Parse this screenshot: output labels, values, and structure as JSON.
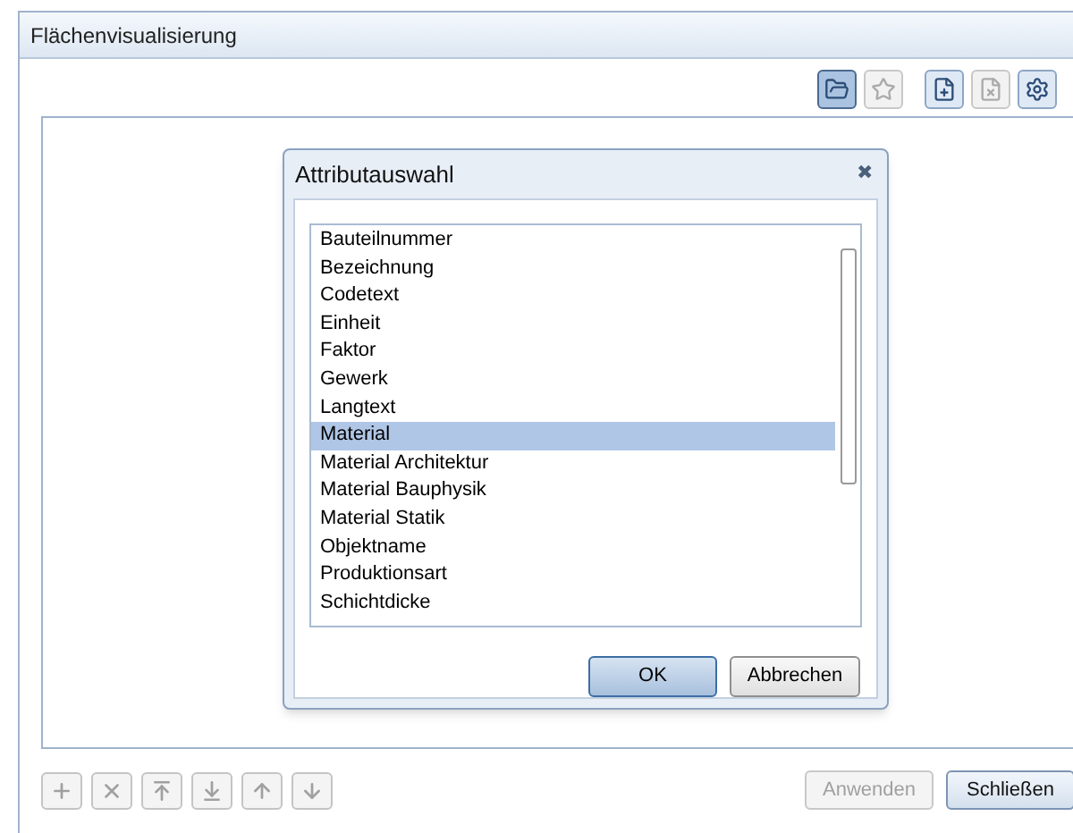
{
  "window": {
    "title": "Flächenvisualisierung"
  },
  "toolbar": [
    {
      "kind": "open",
      "selected": true,
      "disabled": false
    },
    {
      "kind": "favorite",
      "selected": false,
      "disabled": true
    },
    {
      "kind": "add-list",
      "selected": false,
      "disabled": false
    },
    {
      "kind": "remove-list",
      "selected": false,
      "disabled": true
    },
    {
      "kind": "settings",
      "selected": false,
      "disabled": false
    }
  ],
  "dialog": {
    "title": "Attributauswahl",
    "close": "✖",
    "items": [
      {
        "label": "Bauteilnummer",
        "selected": false
      },
      {
        "label": "Bezeichnung",
        "selected": false
      },
      {
        "label": "Codetext",
        "selected": false
      },
      {
        "label": "Einheit",
        "selected": false
      },
      {
        "label": "Faktor",
        "selected": false
      },
      {
        "label": "Gewerk",
        "selected": false
      },
      {
        "label": "Langtext",
        "selected": false
      },
      {
        "label": "Material",
        "selected": true
      },
      {
        "label": "Material Architektur",
        "selected": false
      },
      {
        "label": "Material Bauphysik",
        "selected": false
      },
      {
        "label": "Material Statik",
        "selected": false
      },
      {
        "label": "Objektname",
        "selected": false
      },
      {
        "label": "Produktionsart",
        "selected": false
      },
      {
        "label": "Schichtdicke",
        "selected": false
      }
    ],
    "buttons": [
      {
        "label": "OK",
        "default": true
      },
      {
        "label": "Abbrechen",
        "default": false
      }
    ]
  },
  "bottom_tools": [
    {
      "kind": "add",
      "disabled": true
    },
    {
      "kind": "delete",
      "disabled": true
    },
    {
      "kind": "top",
      "disabled": true
    },
    {
      "kind": "bottom",
      "disabled": true
    },
    {
      "kind": "up",
      "disabled": true
    },
    {
      "kind": "down",
      "disabled": true
    }
  ],
  "buttons": [
    {
      "label": "Anwenden",
      "disabled": true
    },
    {
      "label": "Schließen",
      "disabled": false
    }
  ]
}
